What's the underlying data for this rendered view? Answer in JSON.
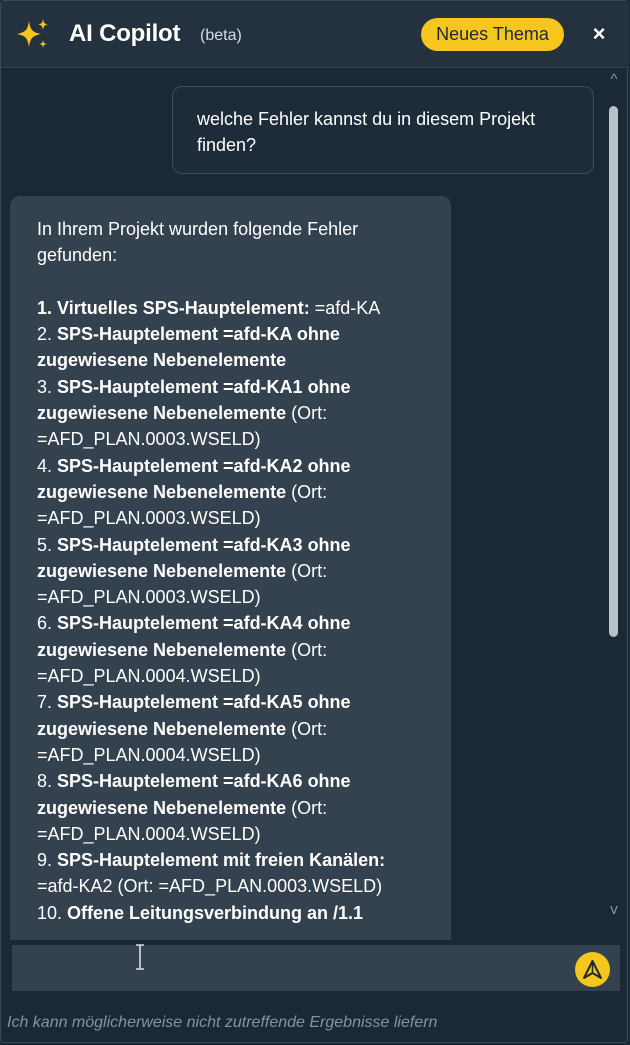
{
  "header": {
    "title": "AI Copilot",
    "beta": "(beta)",
    "new_topic_label": "Neues Thema",
    "close_label": "×",
    "icon": "sparkle-icon",
    "accent_color": "#f5c61e"
  },
  "chat": {
    "user_message": "welche Fehler kannst du in diesem Projekt finden?",
    "bot_intro": [
      "In Ihrem Projekt wurden folgende Fehler",
      "gefunden:"
    ],
    "bot_lines": [
      [
        {
          "b": "1. "
        },
        {
          "b": "Virtuelles SPS-Hauptelement:"
        },
        {
          "t": " =afd-KA"
        }
      ],
      [
        {
          "t": "2. "
        },
        {
          "b": "SPS-Hauptelement =afd-KA ohne"
        }
      ],
      [
        {
          "b": "zugewiesene Nebenelemente"
        }
      ],
      [
        {
          "t": "3. "
        },
        {
          "b": "SPS-Hauptelement =afd-KA1 ohne"
        }
      ],
      [
        {
          "b": "zugewiesene Nebenelemente"
        },
        {
          "t": " (Ort:"
        }
      ],
      [
        {
          "t": "=AFD_PLAN.0003.WSELD)"
        }
      ],
      [
        {
          "t": "4. "
        },
        {
          "b": "SPS-Hauptelement =afd-KA2 ohne"
        }
      ],
      [
        {
          "b": "zugewiesene Nebenelemente"
        },
        {
          "t": " (Ort:"
        }
      ],
      [
        {
          "t": "=AFD_PLAN.0003.WSELD)"
        }
      ],
      [
        {
          "t": "5. "
        },
        {
          "b": "SPS-Hauptelement =afd-KA3 ohne"
        }
      ],
      [
        {
          "b": "zugewiesene Nebenelemente"
        },
        {
          "t": " (Ort:"
        }
      ],
      [
        {
          "t": "=AFD_PLAN.0003.WSELD)"
        }
      ],
      [
        {
          "t": "6. "
        },
        {
          "b": "SPS-Hauptelement =afd-KA4 ohne"
        }
      ],
      [
        {
          "b": "zugewiesene Nebenelemente"
        },
        {
          "t": " (Ort:"
        }
      ],
      [
        {
          "t": "=AFD_PLAN.0004.WSELD)"
        }
      ],
      [
        {
          "t": "7. "
        },
        {
          "b": "SPS-Hauptelement =afd-KA5 ohne"
        }
      ],
      [
        {
          "b": "zugewiesene Nebenelemente"
        },
        {
          "t": " (Ort:"
        }
      ],
      [
        {
          "t": "=AFD_PLAN.0004.WSELD)"
        }
      ],
      [
        {
          "t": "8. "
        },
        {
          "b": "SPS-Hauptelement =afd-KA6 ohne"
        }
      ],
      [
        {
          "b": "zugewiesene Nebenelemente"
        },
        {
          "t": " (Ort:"
        }
      ],
      [
        {
          "t": "=AFD_PLAN.0004.WSELD)"
        }
      ],
      [
        {
          "t": "9. "
        },
        {
          "b": "SPS-Hauptelement mit freien Kanälen:"
        }
      ],
      [
        {
          "t": "=afd-KA2 (Ort: =AFD_PLAN.0003.WSELD)"
        }
      ],
      [
        {
          "t": "10. "
        },
        {
          "b": "Offene Leitungsverbindung an /1.1"
        }
      ]
    ]
  },
  "scrollbar": {
    "up": "^",
    "down": "v"
  },
  "input": {
    "value": "",
    "placeholder": ""
  },
  "send_icon": "send-icon",
  "disclaimer": "Ich kann möglicherweise nicht zutreffende Ergebnisse liefern"
}
